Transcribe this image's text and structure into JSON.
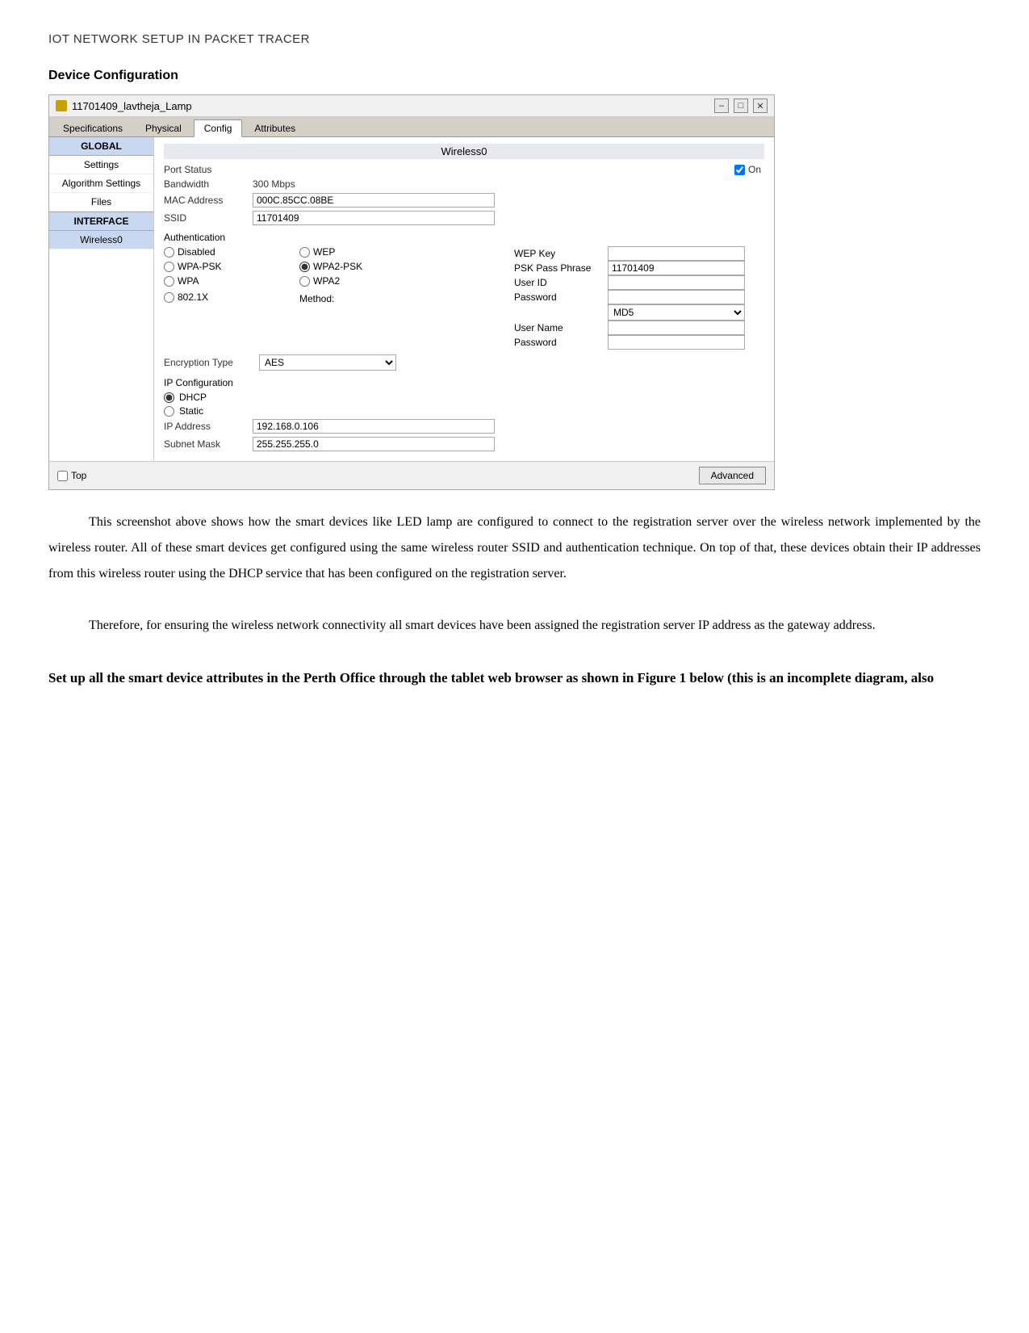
{
  "page": {
    "title": "IOT NETWORK SETUP IN PACKET TRACER",
    "section_heading": "Device Configuration"
  },
  "window": {
    "title": "11701409_lavtheja_Lamp",
    "tabs": [
      "Specifications",
      "Physical",
      "Config",
      "Attributes"
    ],
    "active_tab": "Config"
  },
  "sidebar": {
    "global_label": "GLOBAL",
    "items": [
      "Settings",
      "Algorithm Settings",
      "Files"
    ],
    "interface_label": "INTERFACE",
    "interface_items": [
      "Wireless0"
    ]
  },
  "main": {
    "section_title": "Wireless0",
    "port_status_label": "Port Status",
    "port_status_checked": true,
    "on_label": "On",
    "bandwidth_label": "Bandwidth",
    "bandwidth_value": "300 Mbps",
    "mac_label": "MAC Address",
    "mac_value": "000C.85CC.08BE",
    "ssid_label": "SSID",
    "ssid_value": "11701409",
    "authentication": {
      "title": "Authentication",
      "options": [
        {
          "id": "disabled",
          "label": "Disabled",
          "checked": false
        },
        {
          "id": "wep",
          "label": "WEP",
          "checked": false
        },
        {
          "id": "wpa-psk",
          "label": "WPA-PSK",
          "checked": false
        },
        {
          "id": "wpa2-psk",
          "label": "WPA2-PSK",
          "checked": true
        },
        {
          "id": "wpa",
          "label": "WPA",
          "checked": false
        },
        {
          "id": "wpa2",
          "label": "WPA2",
          "checked": false
        },
        {
          "id": "8021x",
          "label": "802.1X",
          "checked": false
        }
      ],
      "method_label": "Method:",
      "method_value": "MD5",
      "right_fields": [
        {
          "label": "WEP Key",
          "value": ""
        },
        {
          "label": "PSK Pass Phrase",
          "value": "11701409"
        },
        {
          "label": "User ID",
          "value": ""
        },
        {
          "label": "Password",
          "value": ""
        },
        {
          "label": "User Name",
          "value": ""
        },
        {
          "label": "Password",
          "value": ""
        }
      ]
    },
    "encryption": {
      "label": "Encryption Type",
      "value": "AES"
    },
    "ip_config": {
      "title": "IP Configuration",
      "dhcp_label": "DHCP",
      "static_label": "Static",
      "dhcp_checked": true,
      "ip_label": "IP Address",
      "ip_value": "192.168.0.106",
      "subnet_label": "Subnet Mask",
      "subnet_value": "255.255.255.0"
    }
  },
  "bottom": {
    "top_label": "Top",
    "advanced_label": "Advanced"
  },
  "paragraphs": {
    "p1": "This screenshot above shows how the smart devices like LED lamp are configured to connect to the registration server over the wireless network implemented by the wireless router. All of these smart devices get configured using the same wireless router SSID and authentication technique. On top of that, these devices obtain their IP addresses from this wireless router using the DHCP service that has been configured on the registration server.",
    "p2": "Therefore, for ensuring the wireless network connectivity all smart devices have been assigned the registration server IP address as the gateway address.",
    "p3_bold": "Set up all the smart device attributes in the Perth Office through the tablet web browser as shown in Figure 1 below (this is an incomplete diagram, also"
  }
}
